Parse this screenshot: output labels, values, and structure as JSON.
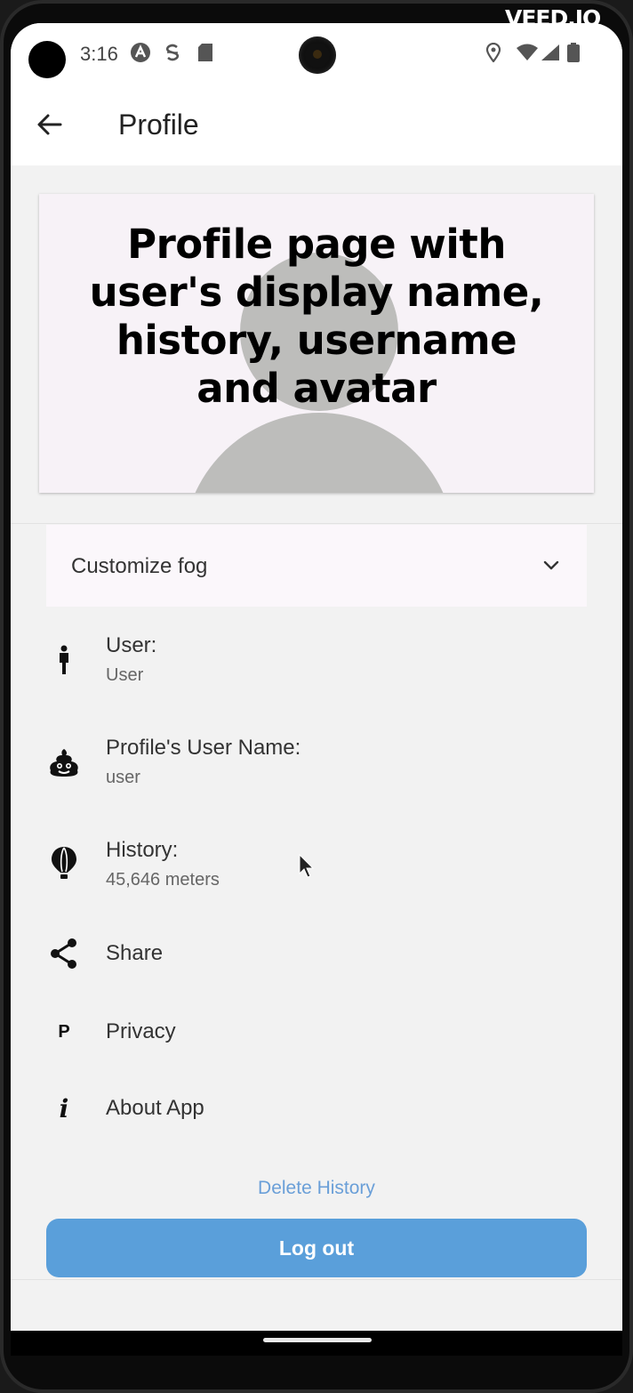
{
  "watermark": "VEED.IO",
  "status_bar": {
    "time": "3:16"
  },
  "app_bar": {
    "title": "Profile"
  },
  "overlay_caption": {
    "lines": [
      "Profile page with",
      "user's display name,",
      "history, username",
      "and avatar"
    ]
  },
  "fog": {
    "label": "Customize fog"
  },
  "profile_items": {
    "user": {
      "title": "User:",
      "value": "User"
    },
    "username": {
      "title": "Profile's User Name:",
      "value": "user"
    },
    "history": {
      "title": "History:",
      "value": "45,646 meters"
    },
    "share": {
      "label": "Share"
    },
    "privacy": {
      "label": "Privacy",
      "icon_glyph": "P"
    },
    "about": {
      "label": "About App",
      "icon_glyph": "i"
    }
  },
  "actions": {
    "delete_history": "Delete History",
    "logout": "Log out"
  },
  "icons": {
    "user": "person-standing-icon",
    "username": "poop-face-icon",
    "history": "hot-air-balloon-icon",
    "share": "share-icon",
    "privacy": "privacy-p-icon",
    "about": "info-icon"
  },
  "colors": {
    "accent": "#5a9fda",
    "link": "#6a9fd8",
    "avatar_placeholder": "#bdbdbb"
  }
}
